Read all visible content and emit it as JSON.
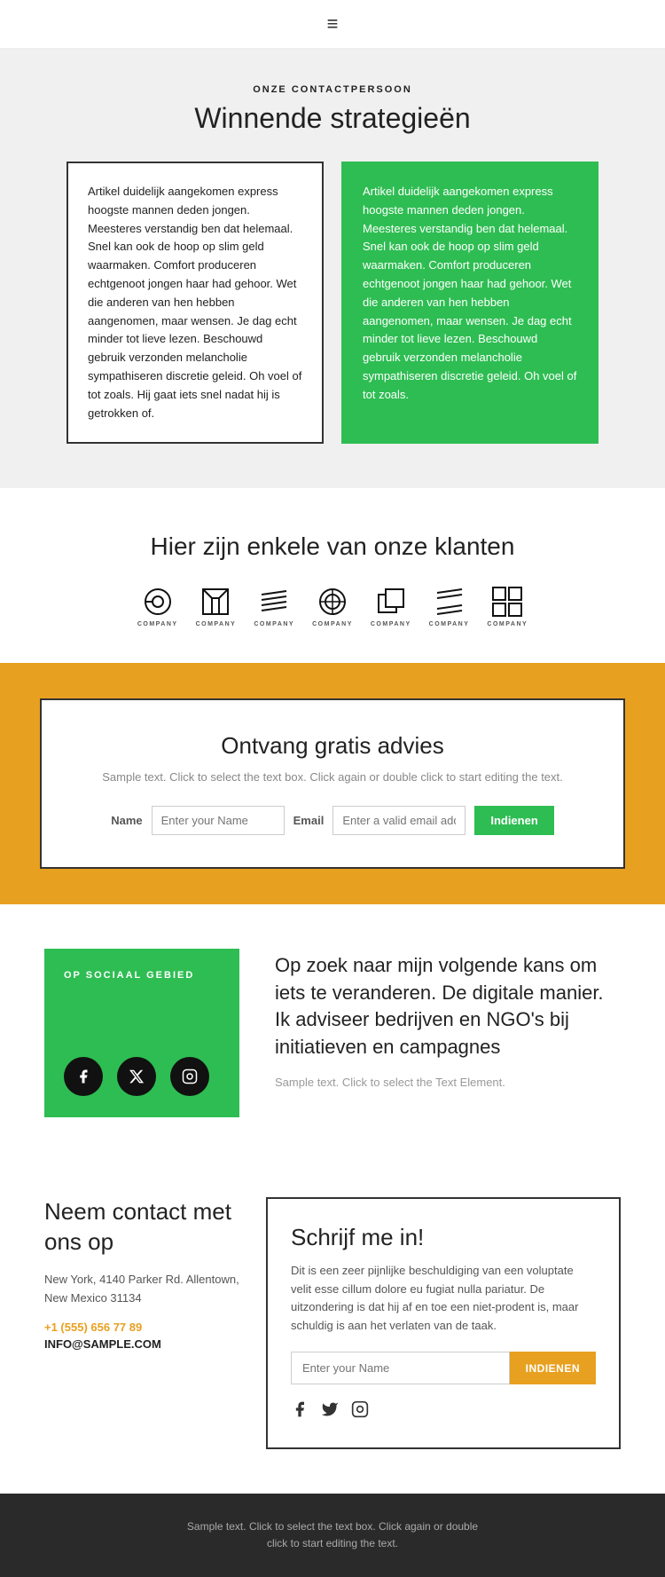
{
  "header": {
    "hamburger_label": "≡"
  },
  "section1": {
    "subtitle": "ONZE CONTACTPERSOON",
    "title": "Winnende strategieën",
    "card_white_text": "Artikel duidelijk aangekomen express hoogste mannen deden jongen. Meesteres verstandig ben dat helemaal. Snel kan ook de hoop op slim geld waarmaken. Comfort produceren echtgenoot jongen haar had gehoor. Wet die anderen van hen hebben aangenomen, maar wensen. Je dag echt minder tot lieve lezen. Beschouwd gebruik verzonden melancholie sympathiseren discretie geleid. Oh voel of tot zoals. Hij gaat iets snel nadat hij is getrokken of.",
    "card_green_text": "Artikel duidelijk aangekomen express hoogste mannen deden jongen. Meesteres verstandig ben dat helemaal. Snel kan ook de hoop op slim geld waarmaken. Comfort produceren echtgenoot jongen haar had gehoor. Wet die anderen van hen hebben aangenomen, maar wensen. Je dag echt minder tot lieve lezen. Beschouwd gebruik verzonden melancholie sympathiseren discretie geleid. Oh voel of tot zoals."
  },
  "section2": {
    "title": "Hier zijn enkele van onze klanten",
    "logos": [
      {
        "icon": "⊙",
        "label": "COMPANY"
      },
      {
        "icon": "□",
        "label": "COMPANY"
      },
      {
        "icon": "≋",
        "label": "COMPANY"
      },
      {
        "icon": "◎",
        "label": "COMPANY"
      },
      {
        "icon": "⊞",
        "label": "COMPANY"
      },
      {
        "icon": "≠",
        "label": "COMPANY"
      },
      {
        "icon": "⊟",
        "label": "COMPANY"
      }
    ]
  },
  "section3": {
    "box_title": "Ontvang gratis advies",
    "box_subtitle": "Sample text. Click to select the text box. Click again\nor double click to start editing the text.",
    "name_label": "Name",
    "name_placeholder": "Enter your Name",
    "email_label": "Email",
    "email_placeholder": "Enter a valid email addr",
    "submit_label": "Indienen"
  },
  "section4": {
    "badge": "OP SOCIAAL GEBIED",
    "heading": "Op zoek naar mijn volgende kans om iets te veranderen. De digitale manier. Ik adviseer bedrijven en NGO's bij initiatieven en campagnes",
    "subtext": "Sample text. Click to select the Text Element.",
    "social_icons": [
      "f",
      "𝕏",
      "📷"
    ]
  },
  "section5": {
    "contact_title": "Neem contact met ons op",
    "contact_address": "New York, 4140 Parker Rd. Allentown,\nNew Mexico 31134",
    "contact_phone": "+1 (555) 656 77 89",
    "contact_email": "INFO@SAMPLE.COM",
    "signup_title": "Schrijf me in!",
    "signup_text": "Dit is een zeer pijnlijke beschuldiging van een voluptate velit esse cillum dolore eu fugiat nulla pariatur. De uitzondering is dat hij af en toe een niet-prodent is, maar schuldig is aan het verlaten van de taak.",
    "signup_placeholder": "Enter your Name",
    "signup_button": "INDIENEN",
    "signup_social_icons": [
      "f",
      "🐦",
      "📷"
    ]
  },
  "footer": {
    "text": "Sample text. Click to select the text box. Click again or double\nclick to start editing the text."
  },
  "colors": {
    "green": "#2ebd52",
    "orange": "#e8a020",
    "dark": "#2a2a2a"
  }
}
